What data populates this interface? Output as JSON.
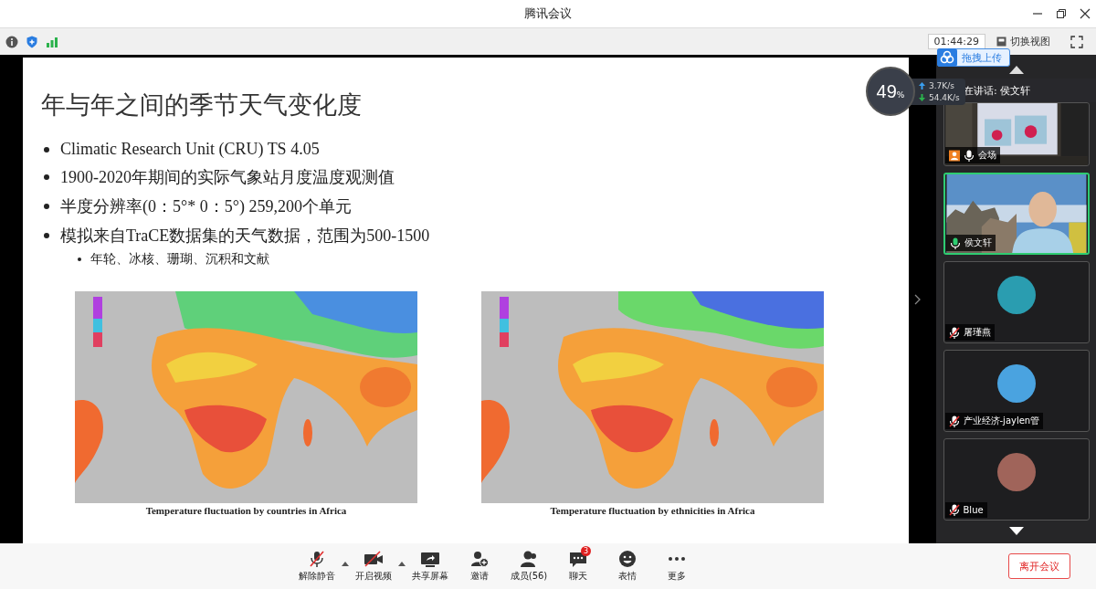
{
  "window": {
    "title": "腾讯会议"
  },
  "toolbar": {
    "timer": "01:44:29",
    "view_button": "切换视图",
    "upload_badge": "拖拽上传"
  },
  "network": {
    "percent": "49",
    "unit": "%",
    "upload": "3.7K/s",
    "download": "54.4K/s"
  },
  "slide": {
    "title": "年与年之间的季节天气变化度",
    "bullets": [
      {
        "text": "Climatic Research Unit (CRU) TS 4.05"
      },
      {
        "text": "1900-2020年期间的实际气象站月度温度观测值"
      },
      {
        "text": "半度分辨率(0：5°* 0：5°) 259,200个单元"
      },
      {
        "text": "模拟来自TraCE数据集的天气数据，范围为500-1500",
        "children": [
          {
            "text": "年轮、冰核、珊瑚、沉积和文献"
          }
        ]
      }
    ],
    "figures": [
      {
        "kind": "picture",
        "caption": "Temperature fluctuation by countries in Africa"
      },
      {
        "kind": "picture",
        "caption": "Temperature fluctuation by ethnicities in Africa"
      }
    ]
  },
  "participants": {
    "speaking_label": "在讲话: 侯文轩",
    "tiles": [
      {
        "kind": "venue",
        "name": "会场",
        "muted": false,
        "speaking": false
      },
      {
        "kind": "video",
        "name": "侯文轩",
        "muted": false,
        "speaking": true
      },
      {
        "kind": "avatar",
        "name": "屠瑾燕",
        "muted": true,
        "speaking": false,
        "color": "#2a9db0"
      },
      {
        "kind": "avatar",
        "name": "产业经济-jaylen管",
        "muted": true,
        "speaking": false,
        "color": "#4aa3e0"
      },
      {
        "kind": "avatar",
        "name": "Blue",
        "muted": true,
        "speaking": false,
        "color": "#a0645a"
      }
    ]
  },
  "controls": [
    {
      "kind": "mic-off",
      "label": "解除静音",
      "menu": true
    },
    {
      "kind": "camera-off",
      "label": "开启视频",
      "menu": true
    },
    {
      "kind": "share",
      "label": "共享屏幕",
      "menu": false
    },
    {
      "kind": "invite",
      "label": "邀请",
      "menu": false
    },
    {
      "kind": "members",
      "label": "成员(56)",
      "menu": false
    },
    {
      "kind": "chat",
      "label": "聊天",
      "menu": false,
      "badge": "3"
    },
    {
      "kind": "emoji",
      "label": "表情",
      "menu": false
    },
    {
      "kind": "more",
      "label": "更多",
      "menu": false
    }
  ],
  "leave_button": "离开会议"
}
